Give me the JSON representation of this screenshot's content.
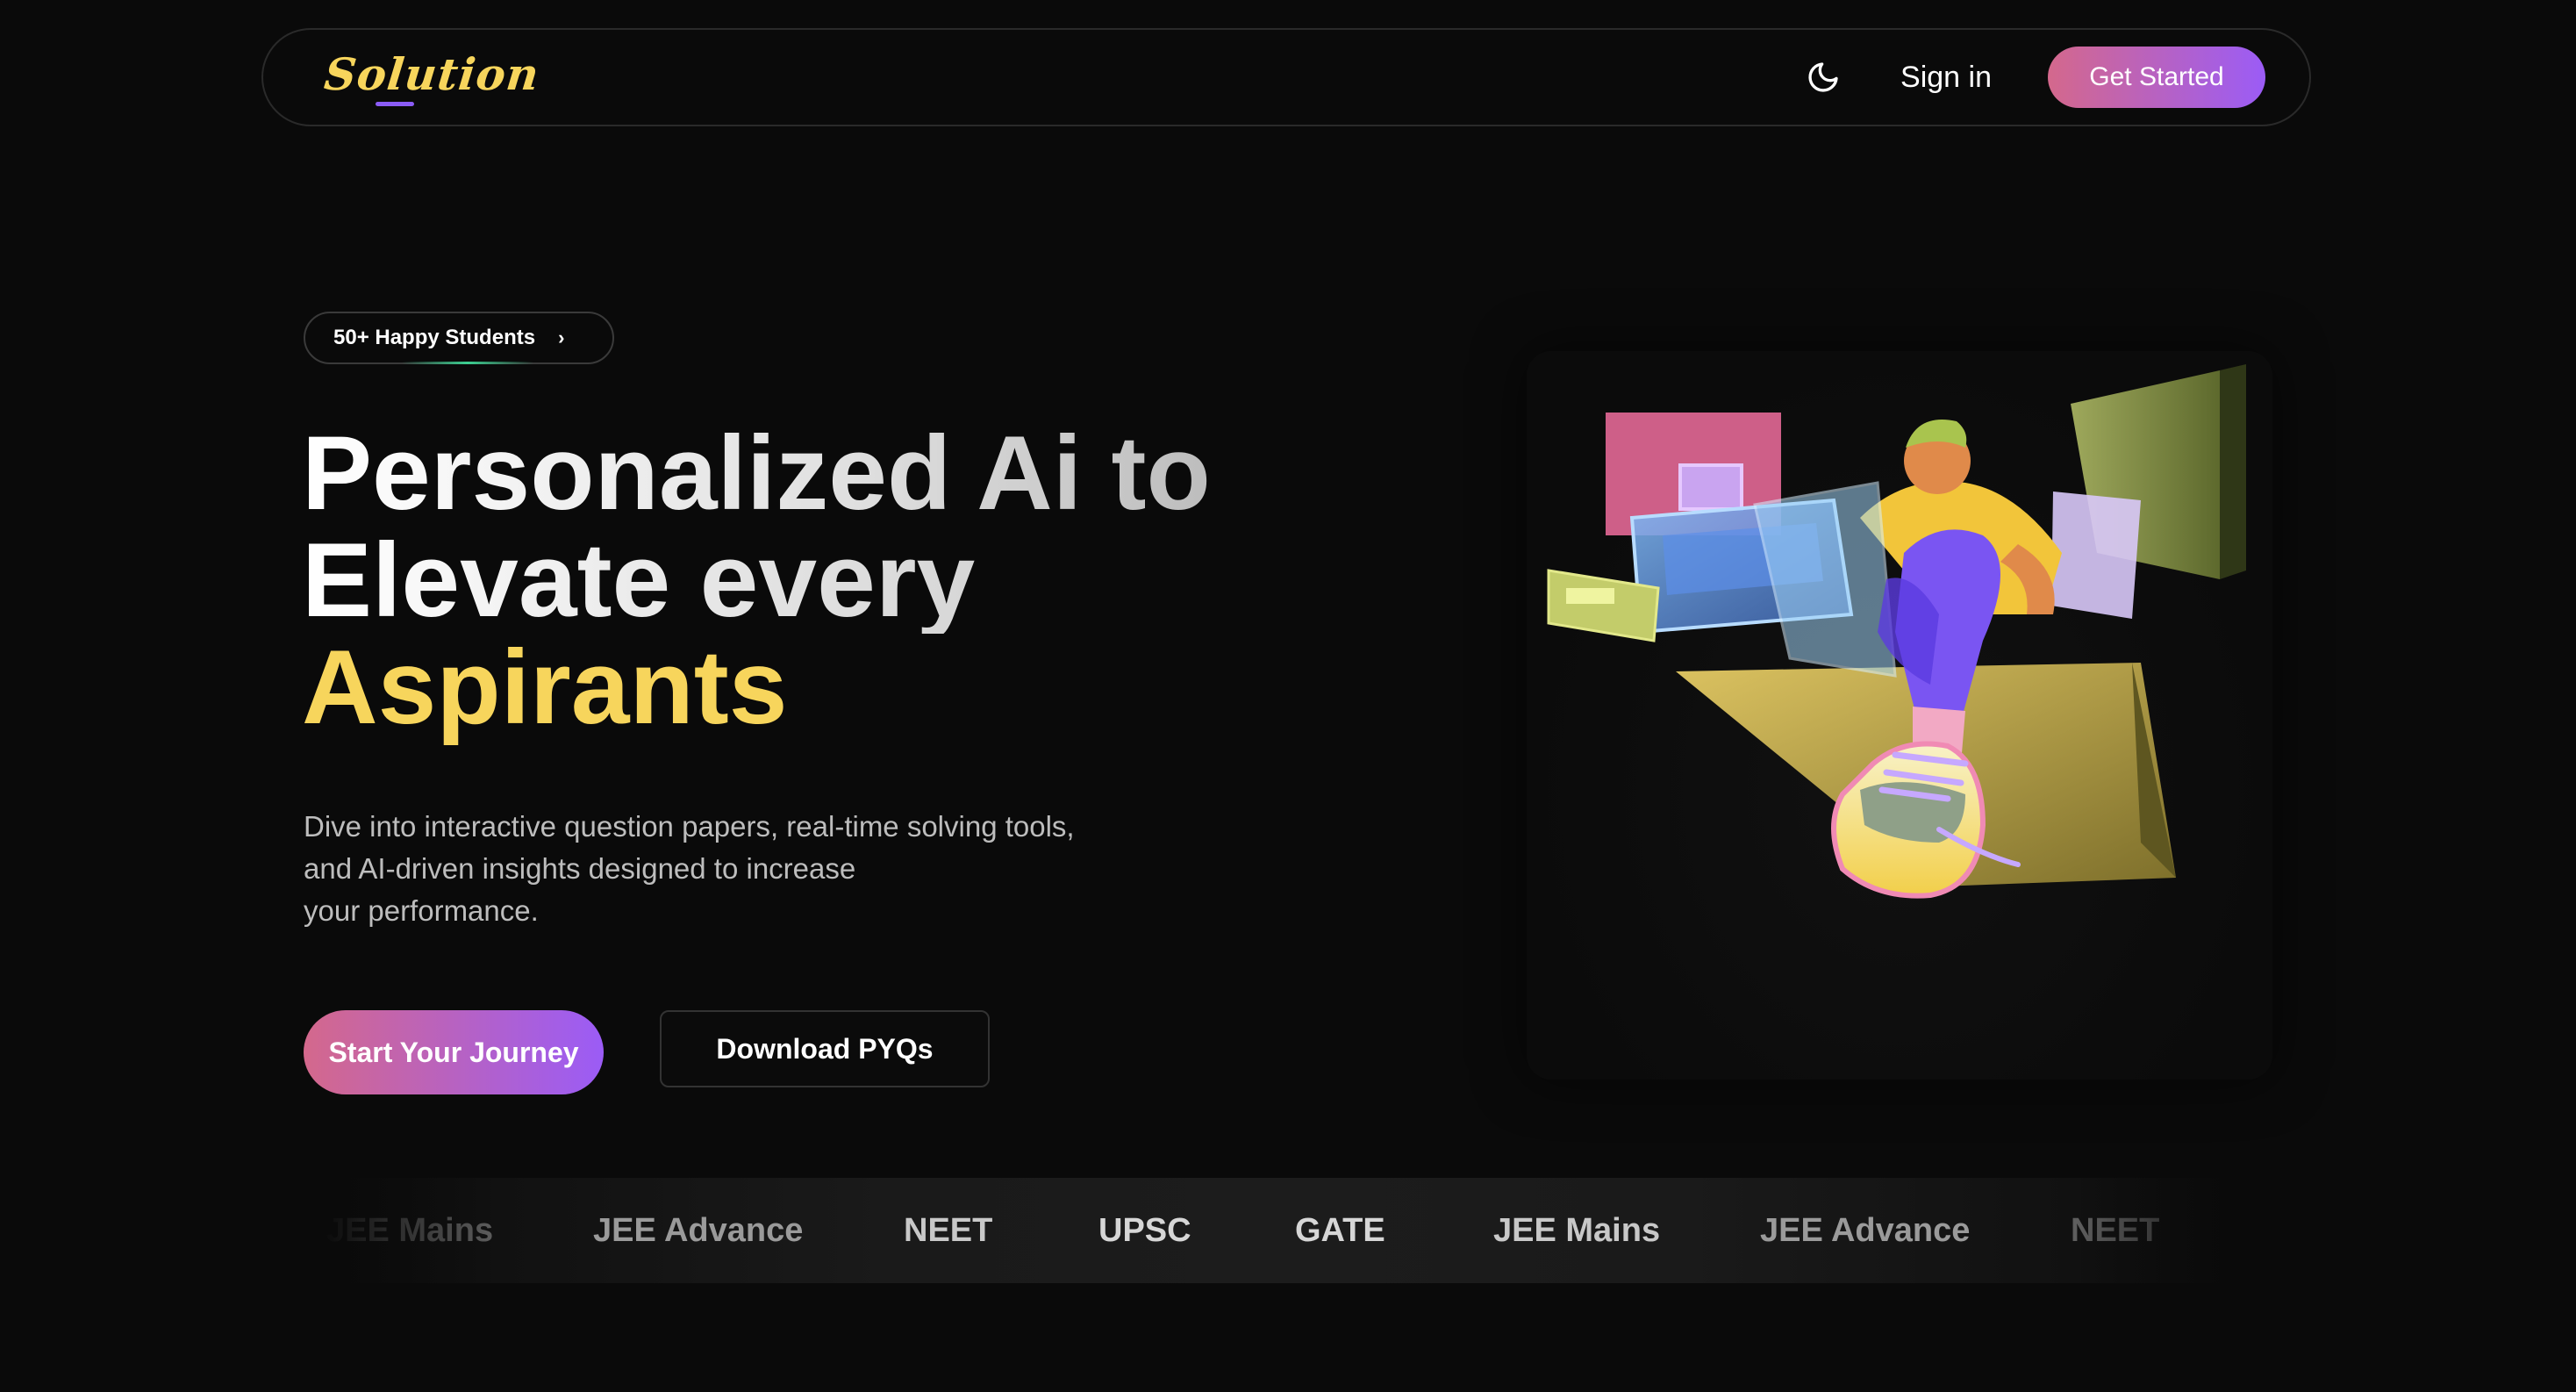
{
  "navbar": {
    "logo_text": "Solution",
    "theme_icon": "moon-icon",
    "signin_label": "Sign in",
    "get_started_label": "Get Started"
  },
  "hero": {
    "badge_label": "50+ Happy Students",
    "badge_icon": "chevron-right-icon",
    "headline_line1": "Personalized Ai to",
    "headline_line2": "Elevate every",
    "headline_line3": "Aspirants",
    "description_lines": [
      "Dive into interactive question papers, real-time solving tools,",
      "and AI-driven insights designed to increase",
      "your performance."
    ],
    "primary_cta": "Start Your Journey",
    "secondary_cta": "Download PYQs",
    "illustration": "person-at-screens-illustration"
  },
  "exams": [
    "JEE Mains",
    "JEE Advance",
    "NEET",
    "UPSC",
    "GATE",
    "JEE Mains",
    "JEE Advance",
    "NEET"
  ],
  "colors": {
    "background": "#0a0a0a",
    "accent_yellow": "#f7d55c",
    "gradient_start": "#d4688c",
    "gradient_end": "#9b5cf6",
    "logo_underline": "#8b5cf6"
  }
}
